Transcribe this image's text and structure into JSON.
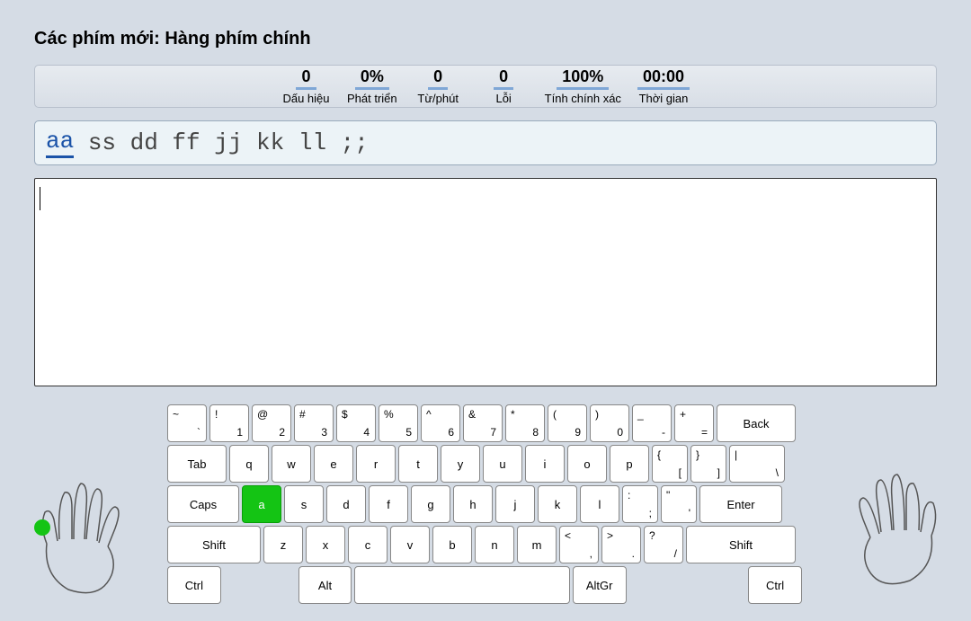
{
  "title": "Các phím mới: Hàng phím chính",
  "stats": [
    {
      "value": "0",
      "label": "Dấu hiệu"
    },
    {
      "value": "0%",
      "label": "Phát triển"
    },
    {
      "value": "0",
      "label": "Từ/phút"
    },
    {
      "value": "0",
      "label": "Lỗi"
    },
    {
      "value": "100%",
      "label": "Tính chính xác"
    },
    {
      "value": "00:00",
      "label": "Thời gian"
    }
  ],
  "target": {
    "highlighted": "aa",
    "rest": " ss dd ff jj kk ll ;;"
  },
  "input_value": "",
  "keyboard": {
    "labels": {
      "tab": "Tab",
      "caps": "Caps",
      "shift_l": "Shift",
      "shift_r": "Shift",
      "ctrl_l": "Ctrl",
      "ctrl_r": "Ctrl",
      "alt": "Alt",
      "altgr": "AltGr",
      "enter": "Enter",
      "back": "Back"
    },
    "row1": [
      {
        "top": "~",
        "bottom": "`"
      },
      {
        "top": "!",
        "bottom": "1"
      },
      {
        "top": "@",
        "bottom": "2"
      },
      {
        "top": "#",
        "bottom": "3"
      },
      {
        "top": "$",
        "bottom": "4"
      },
      {
        "top": "%",
        "bottom": "5"
      },
      {
        "top": "^",
        "bottom": "6"
      },
      {
        "top": "&",
        "bottom": "7"
      },
      {
        "top": "*",
        "bottom": "8"
      },
      {
        "top": "(",
        "bottom": "9"
      },
      {
        "top": ")",
        "bottom": "0"
      },
      {
        "top": "_",
        "bottom": "-"
      },
      {
        "top": "+",
        "bottom": "="
      }
    ],
    "row2_letters": [
      "q",
      "w",
      "e",
      "r",
      "t",
      "y",
      "u",
      "i",
      "o",
      "p"
    ],
    "row2_brackets": [
      {
        "top": "{",
        "bottom": "["
      },
      {
        "top": "}",
        "bottom": "]"
      }
    ],
    "row2_pipe": {
      "top": "|",
      "bottom": "\\"
    },
    "row3_letters": [
      "a",
      "s",
      "d",
      "f",
      "g",
      "h",
      "j",
      "k",
      "l"
    ],
    "row3_after": [
      {
        "top": ":",
        "bottom": ";"
      },
      {
        "top": "\"",
        "bottom": "'"
      }
    ],
    "row4_letters": [
      "z",
      "x",
      "c",
      "v",
      "b",
      "n",
      "m"
    ],
    "row4_after": [
      {
        "top": "<",
        "bottom": ","
      },
      {
        "top": ">",
        "bottom": "."
      },
      {
        "top": "?",
        "bottom": "/"
      }
    ],
    "active_key": "a"
  }
}
